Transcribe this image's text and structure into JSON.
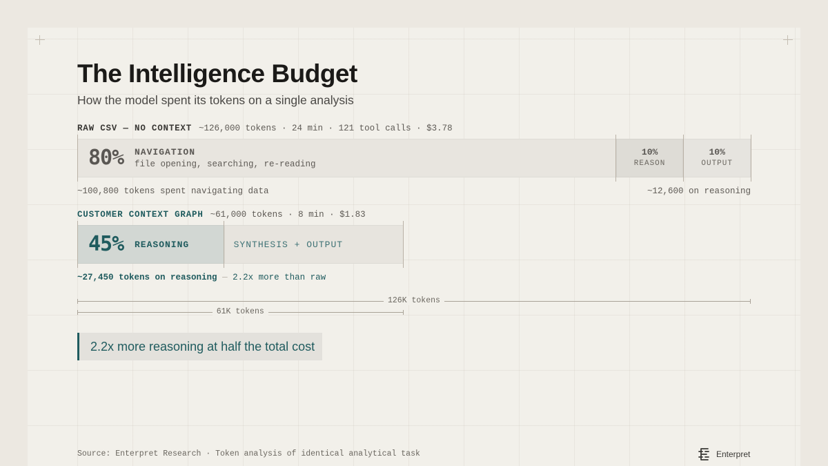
{
  "title": "The Intelligence Budget",
  "subtitle": "How the model spent its tokens on a single analysis",
  "colors": {
    "raw_navigation": "#e8e5df",
    "raw_reason": "#dedcd6",
    "raw_output": "#e6e4df",
    "ctx_reasoning": "#d2d7d3",
    "ctx_synthesis": "#e7e4de",
    "teal": "#1f5b5e",
    "gray_text": "#5e5a55"
  },
  "chart_data": {
    "type": "bar",
    "max_tokens": 126000,
    "series": [
      {
        "label": "RAW CSV — NO CONTEXT",
        "stats": "~126,000 tokens · 24 min · 121 tool calls · $3.78",
        "total_tokens": 126000,
        "segments": [
          {
            "pct": 80,
            "pct_label": "80%",
            "name": "NAVIGATION",
            "desc": "file opening, searching, re-reading"
          },
          {
            "pct": 10,
            "pct_label": "10%",
            "name": "REASON"
          },
          {
            "pct": 10,
            "pct_label": "10%",
            "name": "OUTPUT"
          }
        ],
        "note_left": "~100,800 tokens spent navigating data",
        "note_right": "~12,600 on reasoning"
      },
      {
        "label": "CUSTOMER CONTEXT GRAPH",
        "stats": "~61,000 tokens · 8 min · $1.83",
        "total_tokens": 61000,
        "segments": [
          {
            "pct": 45,
            "pct_label": "45%",
            "name": "REASONING"
          },
          {
            "pct": 55,
            "name": "SYNTHESIS + OUTPUT"
          }
        ],
        "note_left": "~27,450 tokens on reasoning",
        "note_sep": "—",
        "note_right": "2.2x more than raw"
      }
    ],
    "scale": [
      {
        "tokens": 126000,
        "label": "126K tokens"
      },
      {
        "tokens": 61000,
        "label": "61K tokens"
      }
    ]
  },
  "callout": "2.2x more reasoning at half the total cost",
  "source": "Source: Enterpret Research · Token analysis of identical analytical task",
  "brand": {
    "name": "Enterpret",
    "icon": "enterpret-logo-icon"
  }
}
